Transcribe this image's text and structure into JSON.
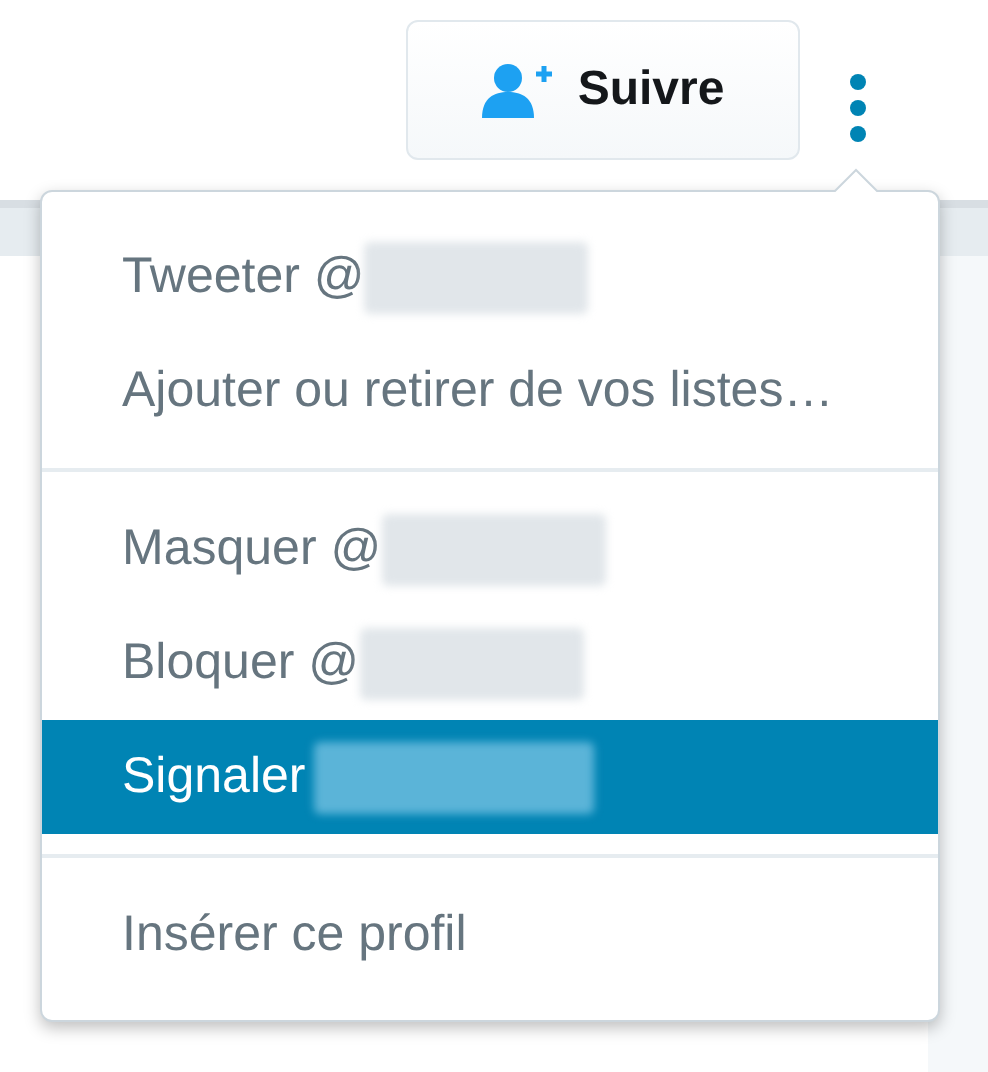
{
  "follow_button": {
    "label": "Suivre"
  },
  "menu": {
    "sections": [
      {
        "items": [
          {
            "label": "Tweeter @",
            "redacted": true,
            "selected": false
          },
          {
            "label": "Ajouter ou retirer de vos listes…",
            "redacted": false,
            "selected": false
          }
        ]
      },
      {
        "items": [
          {
            "label": "Masquer @",
            "redacted": true,
            "selected": false
          },
          {
            "label": "Bloquer @",
            "redacted": true,
            "selected": false
          },
          {
            "label": "Signaler",
            "redacted": true,
            "selected": true
          }
        ]
      },
      {
        "items": [
          {
            "label": "Insérer ce profil",
            "redacted": false,
            "selected": false
          }
        ]
      }
    ]
  }
}
